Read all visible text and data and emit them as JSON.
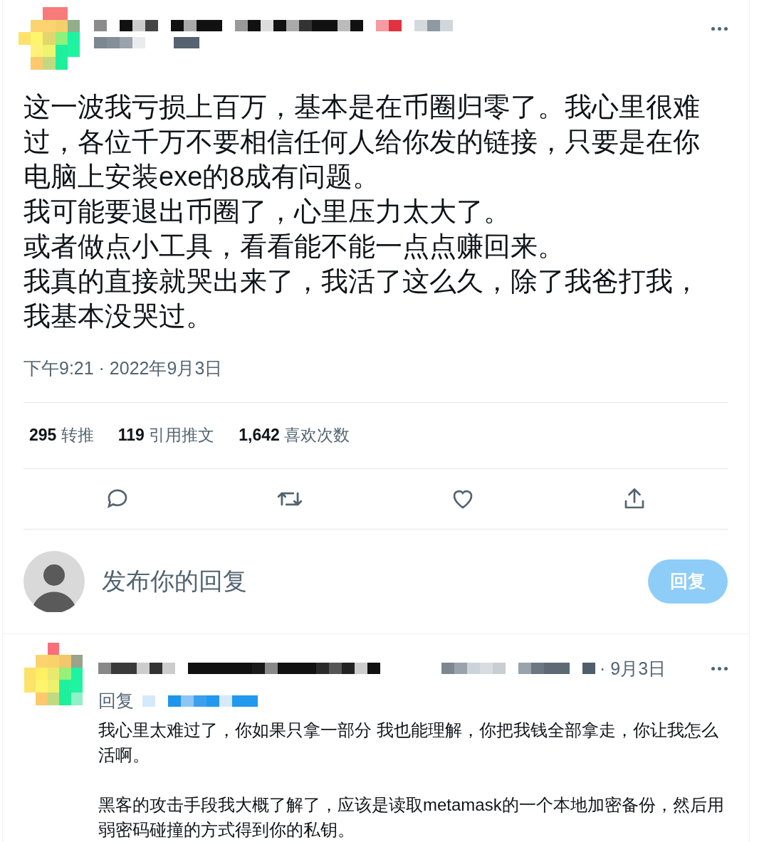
{
  "tweet": {
    "paragraphs": [
      "这一波我亏损上百万，基本是在币圈归零了。我心里很难过，各位千万不要相信任何人给你发的链接，只要是在你电脑上安装exe的8成有问题。",
      "我可能要退出币圈了，心里压力太大了。",
      "或者做点小工具，看看能不能一点点赚回来。",
      "我真的直接就哭出来了，我活了这么久，除了我爸打我，我基本没哭过。"
    ],
    "timestamp": "下午9:21 · 2022年9月3日",
    "stats": [
      {
        "count": "295",
        "label": "转推"
      },
      {
        "count": "119",
        "label": "引用推文"
      },
      {
        "count": "1,642",
        "label": "喜欢次数"
      }
    ]
  },
  "compose": {
    "placeholder": "发布你的回复",
    "button": "回复",
    "disabled": true
  },
  "reply": {
    "date": "· 9月3日",
    "reply_to_label": "回复",
    "paragraphs": [
      "我心里太难过了，你如果只拿一部分 我也能理解，你把我钱全部拿走，你让我怎么活啊。",
      "黑客的攻击手段我大概了解了，应该是读取metamask的一个本地加密备份，然后用弱密码碰撞的方式得到你的私钥。"
    ]
  }
}
